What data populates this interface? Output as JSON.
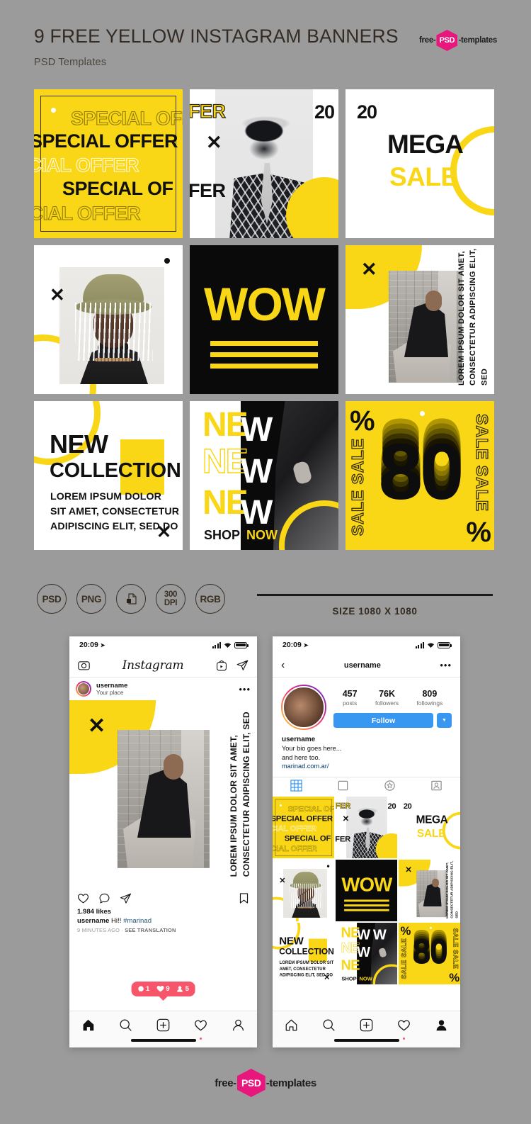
{
  "header": {
    "title": "9 FREE YELLOW INSTAGRAM BANNERS",
    "subtitle": "PSD Templates",
    "logo_left": "free-",
    "logo_mid": "PSD",
    "logo_right": "-templates"
  },
  "banners": {
    "b1": {
      "name": "special-offer",
      "lines": [
        "SPECIAL OFFER",
        "SPECIAL OFFER",
        "ECIAL OFFER",
        "SPECIAL OF",
        "ECIAL OFFER"
      ]
    },
    "b2": {
      "name": "hat-woman",
      "fer_top": "FER",
      "fer_bottom": "FER",
      "number": "20",
      "x": "✕"
    },
    "b3": {
      "name": "mega-sale",
      "number": "20",
      "mega": "MEGA",
      "sale": "SALE"
    },
    "b4": {
      "name": "bucket-hat",
      "x": "✕"
    },
    "b5": {
      "name": "wow",
      "word": "WOW"
    },
    "b6": {
      "name": "sitting-woman",
      "x": "✕",
      "vertical_text": "LOREM IPSUM DOLOR SIT AMET,\nCONSECTETUR ADIPISCING ELIT, SED"
    },
    "b7": {
      "name": "new-collection",
      "new": "NEW",
      "collection": "COLLECTION",
      "lorem": "LOREM IPSUM DOLOR\nSIT AMET, CONSECTETUR\nADIPISCING ELIT, SED DO",
      "x": "✕"
    },
    "b8": {
      "name": "new-shop-now",
      "new1": "NE",
      "new2": "NE",
      "new3": "NE",
      "wcol": "W\nW\nW",
      "shop": "SHOP",
      "now": "NOW"
    },
    "b9": {
      "name": "eighty-percent",
      "number": "80",
      "pct_tl": "%",
      "pct_br": "%",
      "sale_left": "SALE SALE",
      "sale_right": "SALE SALE"
    }
  },
  "badges": [
    {
      "label": "PSD",
      "type": "text"
    },
    {
      "label": "PNG",
      "type": "text"
    },
    {
      "label": "layers-icon",
      "type": "icon"
    },
    {
      "label": "300",
      "label2": "DPI",
      "type": "two-line"
    },
    {
      "label": "RGB",
      "type": "text"
    }
  ],
  "size_info": {
    "label": "SIZE 1080 X 1080"
  },
  "phone_left": {
    "status": {
      "time": "20:09",
      "location_icon": "➤"
    },
    "nav": {
      "camera_icon": "camera-icon",
      "logo": "Instagram",
      "igtv_icon": "igtv-icon",
      "send_icon": "send-icon"
    },
    "post_header": {
      "username": "username",
      "place": "Your place",
      "more": "•••"
    },
    "post": {
      "vertical_text": "LOREM IPSUM DOLOR SIT AMET,\nCONSECTETUR ADIPISCING ELIT, SED",
      "x": "✕"
    },
    "actions": {
      "like": "heart-icon",
      "comment": "comment-icon",
      "share": "share-icon",
      "save": "bookmark-icon"
    },
    "caption": {
      "likes": "1.984 likes",
      "user": "username",
      "text": " Hi!! ",
      "hashtag": "#marinad",
      "time": "9 MINUTES AGO",
      "sep": " · ",
      "translate": "SEE TRANSLATION"
    },
    "notification": {
      "comments": "1",
      "likes": "9",
      "followers": "5"
    },
    "tabbar": [
      "home-icon",
      "search-icon",
      "add-icon",
      "heart-icon",
      "profile-icon"
    ]
  },
  "phone_right": {
    "status": {
      "time": "20:09",
      "location_icon": "➤"
    },
    "nav": {
      "back": "‹",
      "title": "username",
      "more": "•••"
    },
    "stats": [
      {
        "number": "457",
        "label": "posts"
      },
      {
        "number": "76K",
        "label": "followers"
      },
      {
        "number": "809",
        "label": "followings"
      }
    ],
    "follow_button": "Follow",
    "follow_caret": "▼",
    "bio": {
      "name": "username",
      "line1": "Your bio goes here...",
      "line2": "and here too.",
      "link": "marinad.com.ar/"
    },
    "tabs": [
      "grid-icon",
      "feed-icon",
      "reels-icon",
      "tagged-icon"
    ],
    "tabbar": [
      "home-icon",
      "search-icon",
      "add-icon",
      "heart-icon",
      "profile-icon"
    ]
  },
  "footer": {
    "left": "free-",
    "mid": "PSD",
    "right": "-templates"
  },
  "colors": {
    "yellow": "#f9d616",
    "black": "#0a0a0a",
    "bg": "#9b9b9b",
    "blue": "#3897f0",
    "pink": "#e8177d",
    "notif": "#f7566a"
  }
}
